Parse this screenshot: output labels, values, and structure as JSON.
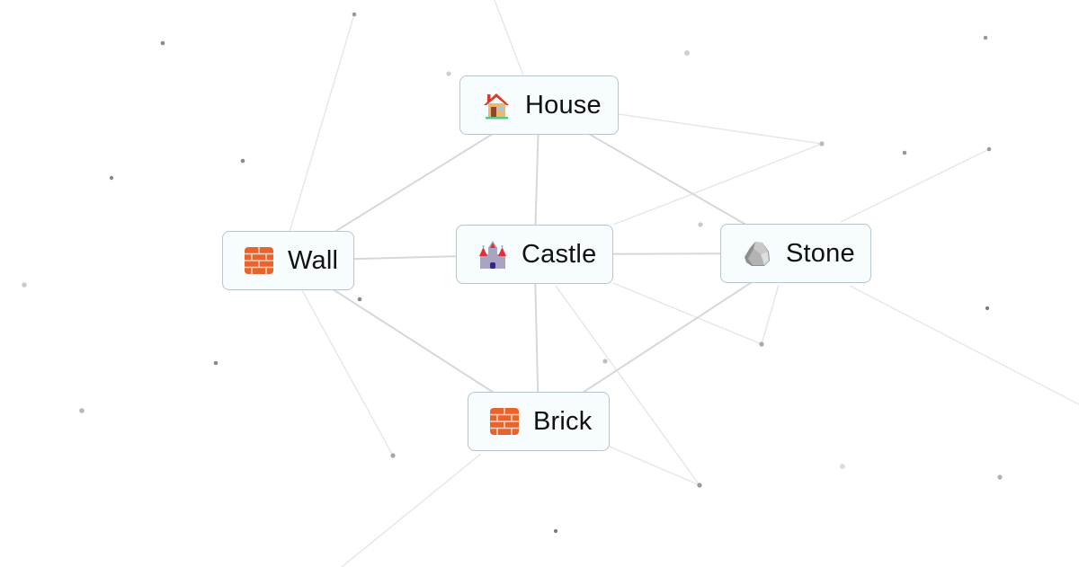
{
  "canvas": {
    "background": "#ffffff",
    "edge_color": "#d4d8dc",
    "dot_color": "#9a9a9a"
  },
  "nodes": [
    {
      "id": "house",
      "label": "House",
      "icon": "house-icon"
    },
    {
      "id": "wall",
      "label": "Wall",
      "icon": "brick-wall-icon"
    },
    {
      "id": "castle",
      "label": "Castle",
      "icon": "castle-icon"
    },
    {
      "id": "stone",
      "label": "Stone",
      "icon": "rock-icon"
    },
    {
      "id": "brick",
      "label": "Brick",
      "icon": "brick-wall-icon"
    }
  ],
  "edges": [
    [
      "house",
      "castle"
    ],
    [
      "house",
      "wall"
    ],
    [
      "house",
      "stone"
    ],
    [
      "wall",
      "castle"
    ],
    [
      "castle",
      "stone"
    ],
    [
      "castle",
      "brick"
    ],
    [
      "wall",
      "brick"
    ],
    [
      "stone",
      "brick"
    ]
  ],
  "colors": {
    "node_bg": "#f7fcfe",
    "node_border": "#b8c4cf",
    "brick": "#e8642c",
    "house_roof": "#d83a2a",
    "castle_body": "#a9a4bf",
    "castle_roof": "#e03038",
    "stone": "#9c9c9c"
  }
}
